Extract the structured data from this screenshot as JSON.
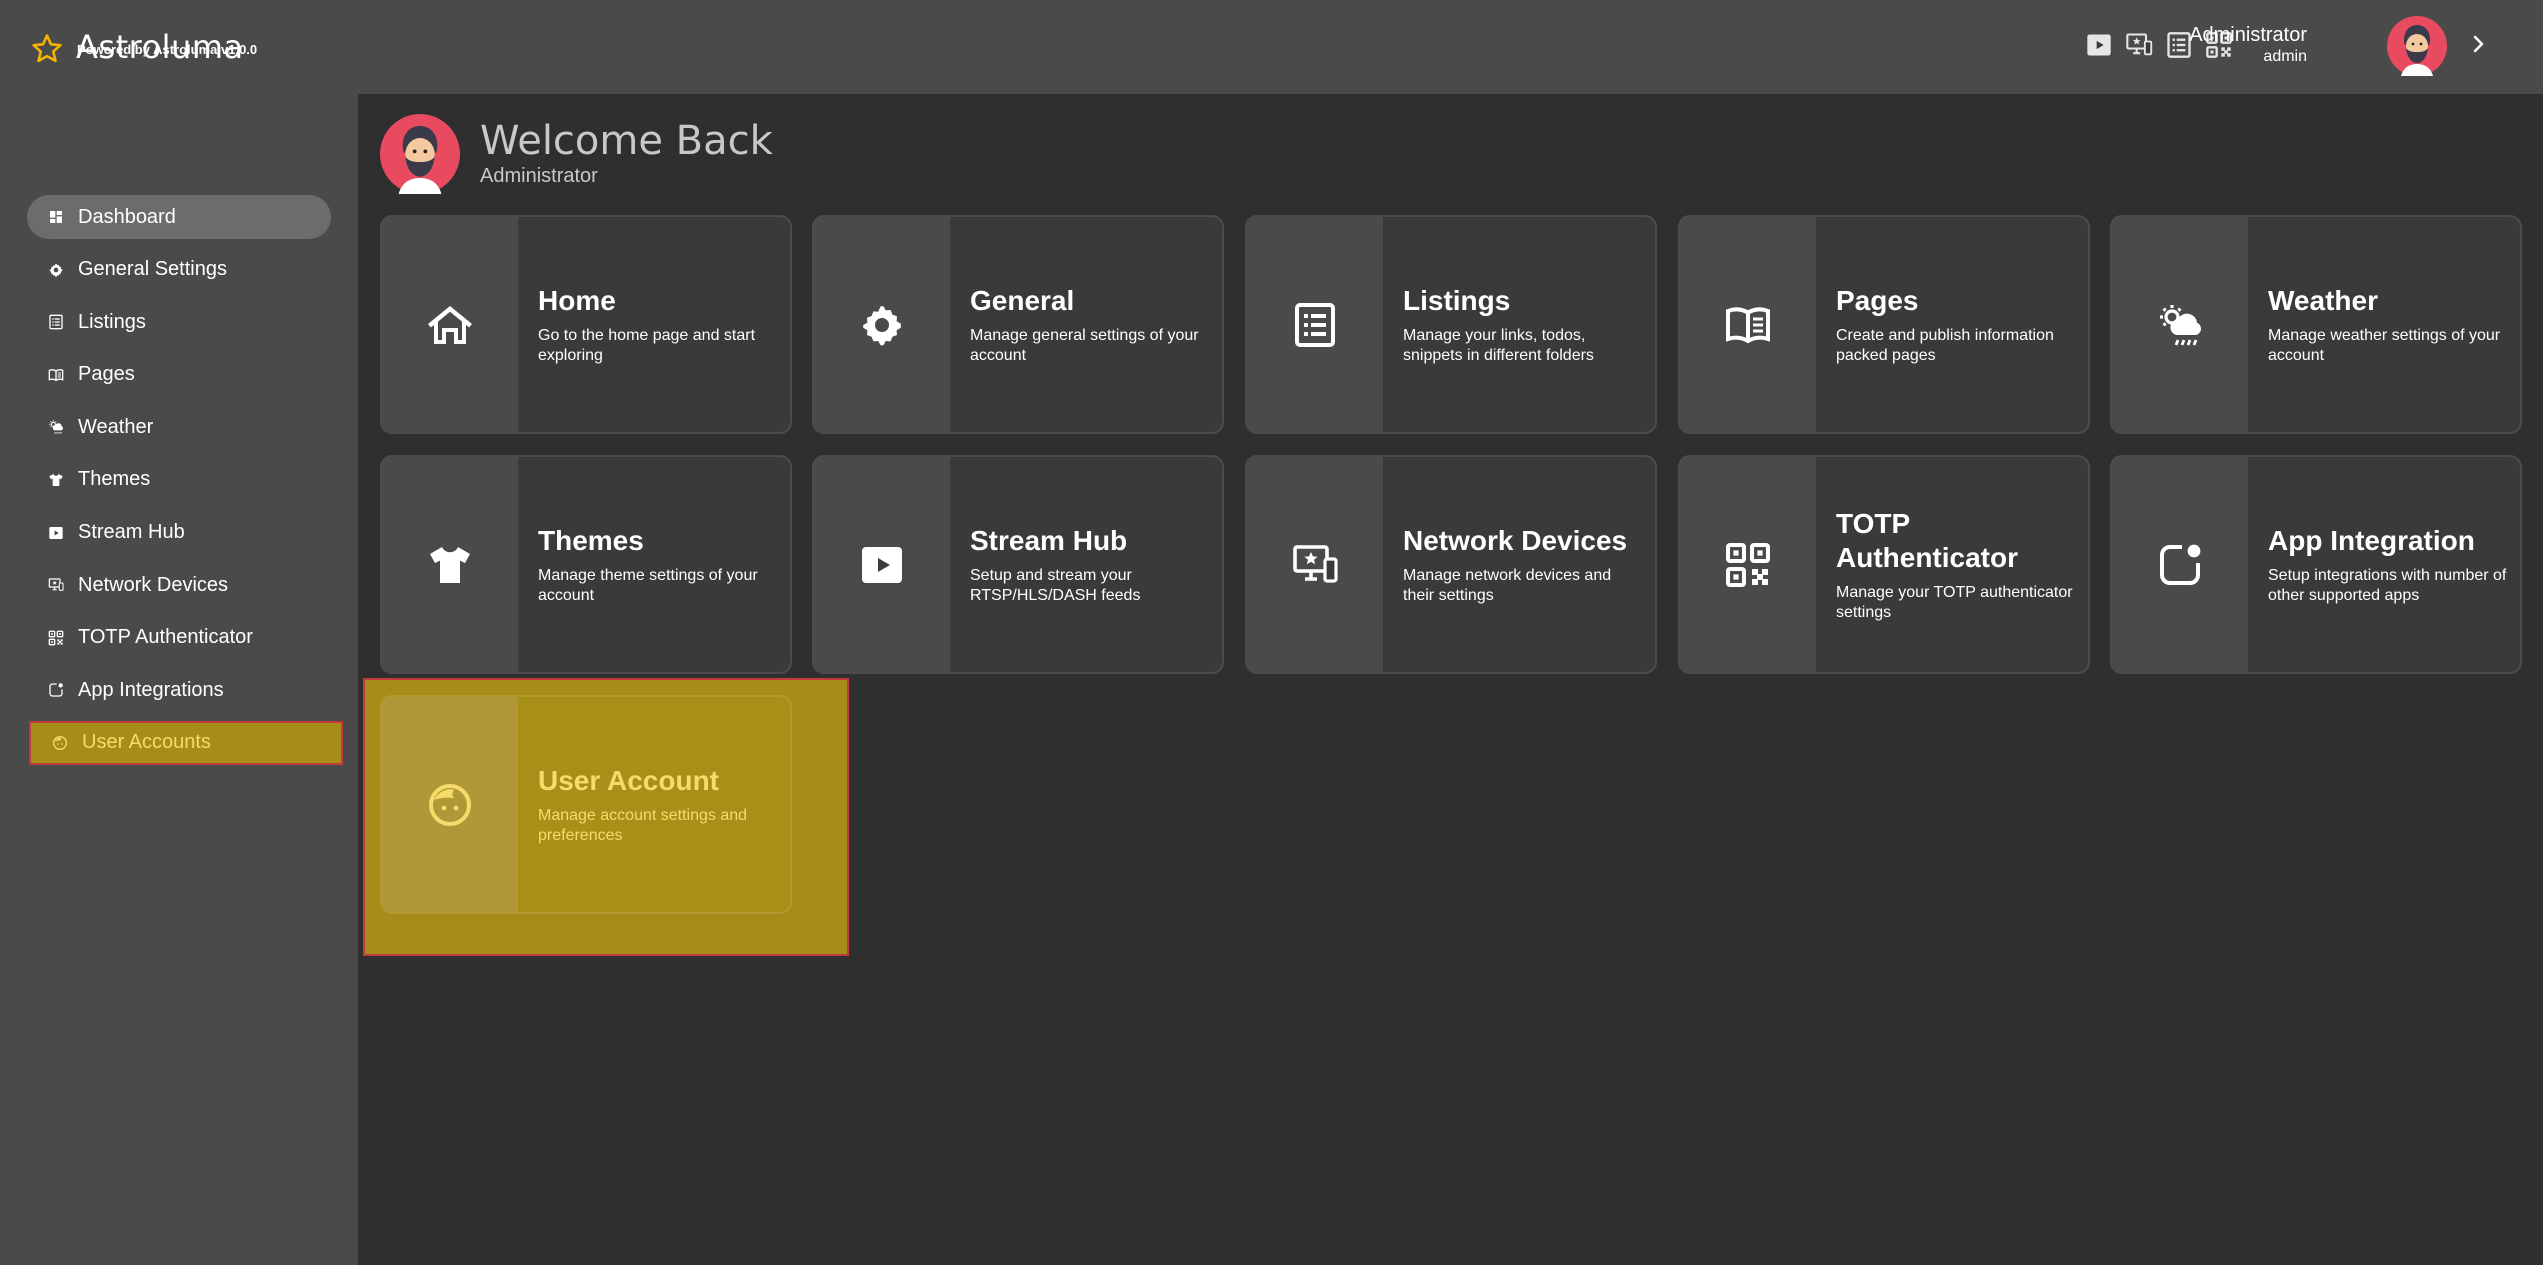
{
  "app": {
    "name": "Astroluma",
    "powered_by": "Powered by Astroluma v1.0.0",
    "accent": "#f5b400",
    "highlight": "#a68c18"
  },
  "topbar": {
    "icons": [
      "stream-icon",
      "network-devices-icon",
      "listings-icon",
      "qr-code-icon"
    ],
    "user_name": "Administrator",
    "user_role": "admin"
  },
  "sidebar": {
    "items": [
      {
        "label": "Dashboard",
        "icon": "dashboard-icon"
      },
      {
        "label": "General Settings",
        "icon": "gear-icon"
      },
      {
        "label": "Listings",
        "icon": "list-icon"
      },
      {
        "label": "Pages",
        "icon": "book-icon"
      },
      {
        "label": "Weather",
        "icon": "weather-icon"
      },
      {
        "label": "Themes",
        "icon": "shirt-icon"
      },
      {
        "label": "Stream Hub",
        "icon": "play-icon"
      },
      {
        "label": "Network Devices",
        "icon": "monitor-icon"
      },
      {
        "label": "TOTP Authenticator",
        "icon": "qr-code-icon"
      },
      {
        "label": "App Integrations",
        "icon": "app-integration-icon"
      },
      {
        "label": "User Accounts",
        "icon": "user-face-icon"
      }
    ]
  },
  "welcome": {
    "title": "Welcome Back",
    "subtitle": "Administrator"
  },
  "cards": [
    {
      "title": "Home",
      "desc": "Go to the home page and start exploring",
      "icon": "home-icon"
    },
    {
      "title": "General",
      "desc": "Manage general settings of your account",
      "icon": "gear-icon"
    },
    {
      "title": "Listings",
      "desc": "Manage your links, todos, snippets in different folders",
      "icon": "list-icon"
    },
    {
      "title": "Pages",
      "desc": "Create and publish information packed pages",
      "icon": "book-icon"
    },
    {
      "title": "Weather",
      "desc": "Manage weather settings of your account",
      "icon": "weather-icon"
    },
    {
      "title": "Themes",
      "desc": "Manage theme settings of your account",
      "icon": "shirt-icon"
    },
    {
      "title": "Stream Hub",
      "desc": "Setup and stream your RTSP/HLS/DASH feeds",
      "icon": "play-icon"
    },
    {
      "title": "Network Devices",
      "desc": "Manage network devices and their settings",
      "icon": "monitor-icon"
    },
    {
      "title": "TOTP Authenticator",
      "desc": "Manage your TOTP authenticator settings",
      "icon": "qr-code-icon"
    },
    {
      "title": "App Integration",
      "desc": "Setup integrations with number of other supported apps",
      "icon": "app-integration-icon"
    },
    {
      "title": "User Account",
      "desc": "Manage account settings and preferences",
      "icon": "user-face-icon"
    }
  ]
}
